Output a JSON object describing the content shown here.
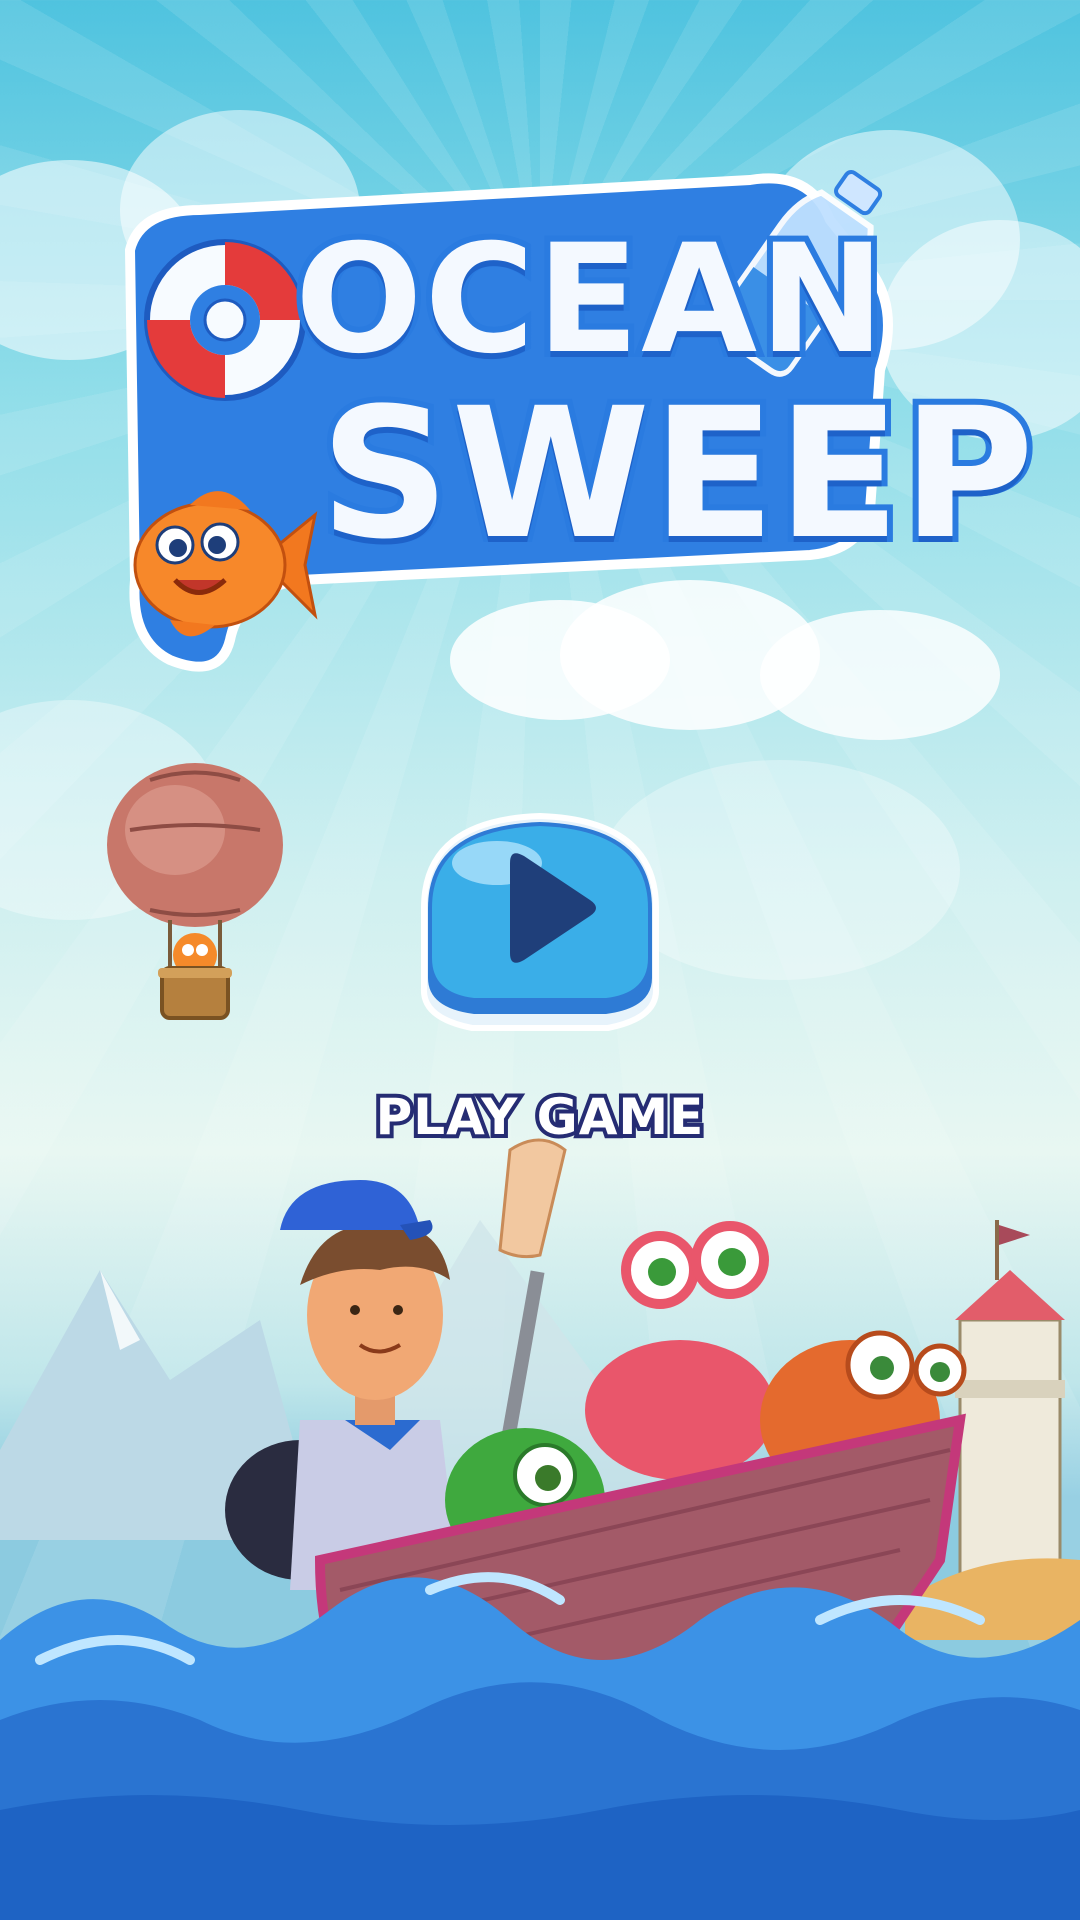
{
  "game": {
    "title_line1": "OCEAN",
    "title_line2": "SWEEP",
    "play_label": "PLAY GAME"
  },
  "icons": {
    "play": "play-icon",
    "balloon": "hot-air-balloon-icon",
    "lifebuoy": "lifebuoy-icon",
    "bottle": "plastic-bottle-icon",
    "fish": "clownfish-icon"
  },
  "colors": {
    "sky_top": "#4fc3df",
    "title_fill": "#f4f9ff",
    "title_stroke": "#2a7be0",
    "button_blue": "#3aaee8",
    "play_triangle": "#1f3f7a",
    "label_stroke": "#252c73",
    "sea": "#1e63c4"
  }
}
